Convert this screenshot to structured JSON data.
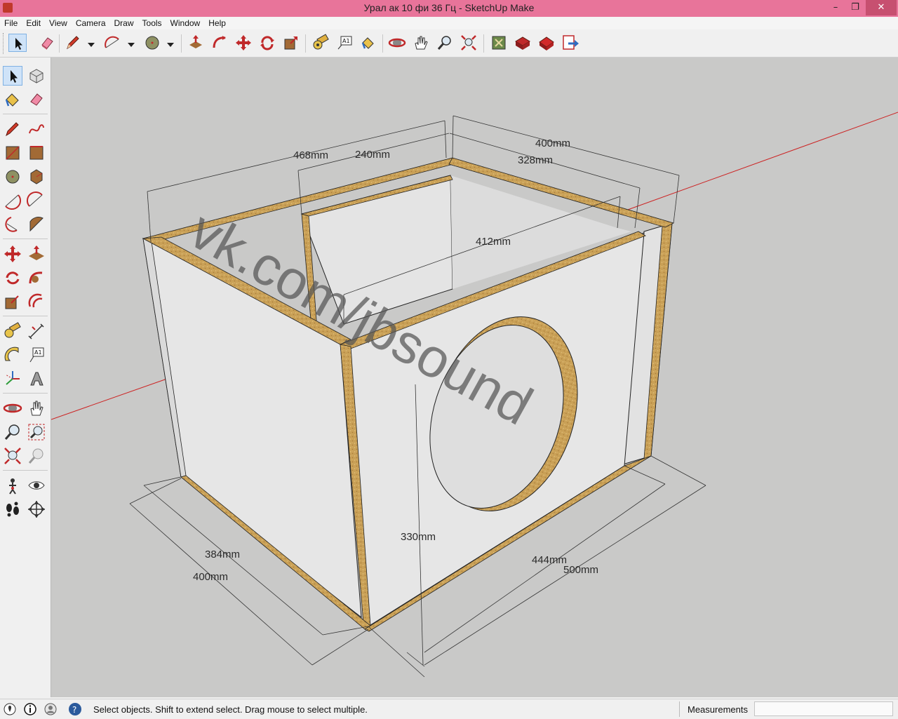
{
  "window": {
    "title": "Урал ак 10 фи 36 Гц - SketchUp Make",
    "minimize": "–",
    "restore": "❐",
    "close": "✕"
  },
  "menu": [
    "File",
    "Edit",
    "View",
    "Camera",
    "Draw",
    "Tools",
    "Window",
    "Help"
  ],
  "toolbar": {
    "tools": [
      "select",
      "eraser",
      "pencil",
      "arc",
      "circle",
      "push-pull",
      "follow-me",
      "move",
      "rotate",
      "scale",
      "tape-measure",
      "text",
      "paint-bucket",
      "orbit",
      "pan",
      "zoom",
      "zoom-extents",
      "3d-warehouse",
      "extension-warehouse",
      "layout",
      "send-to-layout"
    ]
  },
  "sidebar": {
    "tools": [
      "select",
      "make-component",
      "paint-bucket",
      "eraser",
      "pencil",
      "freehand",
      "rectangle",
      "rotated-rectangle",
      "circle",
      "polygon",
      "arc",
      "two-point-arc",
      "three-point-arc",
      "pie",
      "move",
      "push-pull",
      "rotate",
      "follow-me",
      "scale",
      "offset",
      "tape-measure",
      "dimension",
      "protractor",
      "text",
      "axes",
      "3d-text",
      "orbit",
      "pan",
      "zoom",
      "zoom-window",
      "zoom-extents",
      "previous-view",
      "position-camera",
      "look-around",
      "walk",
      "section-plane"
    ]
  },
  "model": {
    "dimensions": [
      "468mm",
      "240mm",
      "400mm",
      "328mm",
      "412mm",
      "330mm",
      "384mm",
      "400mm",
      "444mm",
      "500mm"
    ],
    "watermark": "vk.com/jbsound"
  },
  "status": {
    "message": "Select objects. Shift to extend select. Drag mouse to select multiple.",
    "measurements_label": "Measurements",
    "measurements_value": ""
  },
  "colors": {
    "titlebar": "#e8749a",
    "viewport_bg": "#c9c9c8",
    "panel_face": "#ebebeb",
    "wood": "#c9a056",
    "red_axis": "#cc2222"
  }
}
